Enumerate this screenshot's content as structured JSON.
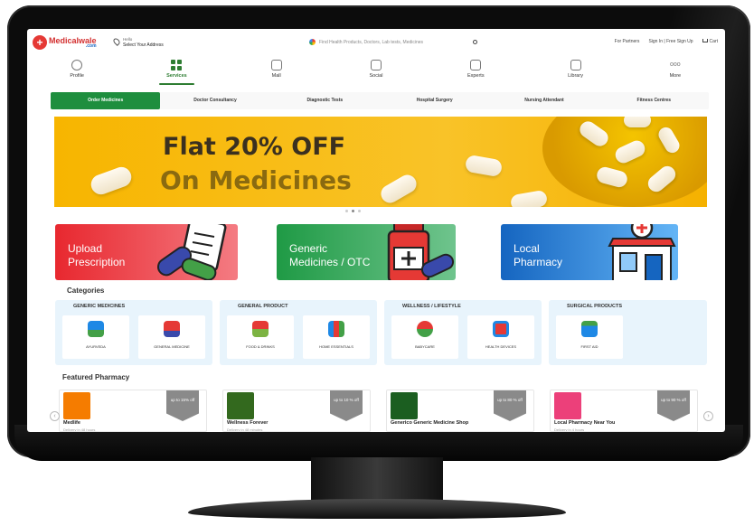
{
  "header": {
    "logo_main": "Medicalwale",
    "logo_sub": ".com",
    "address_hello": "Hello",
    "address_select": "Select Your Address",
    "search_placeholder": "Find Health Products, Doctors, Lab tests, Medicines",
    "for_partners": "For Partners",
    "signin": "Sign In | Free Sign Up",
    "cart": "Cart"
  },
  "nav": [
    {
      "label": "Profile",
      "icon": "user-icon"
    },
    {
      "label": "Services",
      "icon": "services-grid-icon",
      "active": true
    },
    {
      "label": "Mall",
      "icon": "mall-icon"
    },
    {
      "label": "Social",
      "icon": "social-icon"
    },
    {
      "label": "Experts",
      "icon": "experts-icon"
    },
    {
      "label": "Library",
      "icon": "library-icon"
    },
    {
      "label": "More",
      "icon": "more-dots-icon"
    }
  ],
  "service_tabs": [
    {
      "label": "Order Medicines",
      "active": true
    },
    {
      "label": "Doctor Consultancy"
    },
    {
      "label": "Diagnostic Tests"
    },
    {
      "label": "Hospital Surgery"
    },
    {
      "label": "Nursing Attendant"
    },
    {
      "label": "Fitness Centres"
    }
  ],
  "banner": {
    "line1": "Flat 20% OFF",
    "line2": "On Medicines"
  },
  "promos": [
    {
      "line1": "Upload",
      "line2": "Prescription",
      "icon": "prescription-icon"
    },
    {
      "line1": "Generic",
      "line2": "Medicines / OTC",
      "icon": "medicine-bottle-icon"
    },
    {
      "line1": "Local",
      "line2": "Pharmacy",
      "icon": "pharmacy-store-icon"
    }
  ],
  "categories_title": "Categories",
  "categories": [
    {
      "title": "GENERIC MEDICINES",
      "items": [
        {
          "label": "AYURVEDA",
          "icon": "ayurveda-icon"
        },
        {
          "label": "GENERAL MEDICINE",
          "icon": "general-medicine-icon"
        }
      ]
    },
    {
      "title": "GENERAL PRODUCT",
      "items": [
        {
          "label": "FOOD & DRINKS",
          "icon": "food-drinks-icon"
        },
        {
          "label": "HOME ESSENTIALS",
          "icon": "home-essentials-icon"
        }
      ]
    },
    {
      "title": "WELLNESS / LIFESTYLE",
      "items": [
        {
          "label": "BABYCARE",
          "icon": "babycare-icon"
        },
        {
          "label": "HEALTH DEVICES",
          "icon": "health-devices-icon"
        }
      ]
    },
    {
      "title": "SURGICAL PRODUCTS",
      "items": [
        {
          "label": "FIRST AID",
          "icon": "first-aid-icon"
        }
      ]
    }
  ],
  "featured_title": "Featured Pharmacy",
  "featured": [
    {
      "name": "Medlife",
      "sub": "Delivery in 48 hours",
      "badge": "up to 15% off",
      "color": "#f57c00"
    },
    {
      "name": "Wellness Forever",
      "sub": "Delivery in 48 minutes",
      "badge": "up to 10 % off",
      "color": "#33691e"
    },
    {
      "name": "Generico Generic Medicine Shop",
      "sub": "",
      "badge": "up to 80 % off",
      "color": "#1b5e20"
    },
    {
      "name": "Local Pharmacy Near You",
      "sub": "Delivery in 4 hours",
      "badge": "up to 90 % off",
      "color": "#ec407a"
    }
  ]
}
